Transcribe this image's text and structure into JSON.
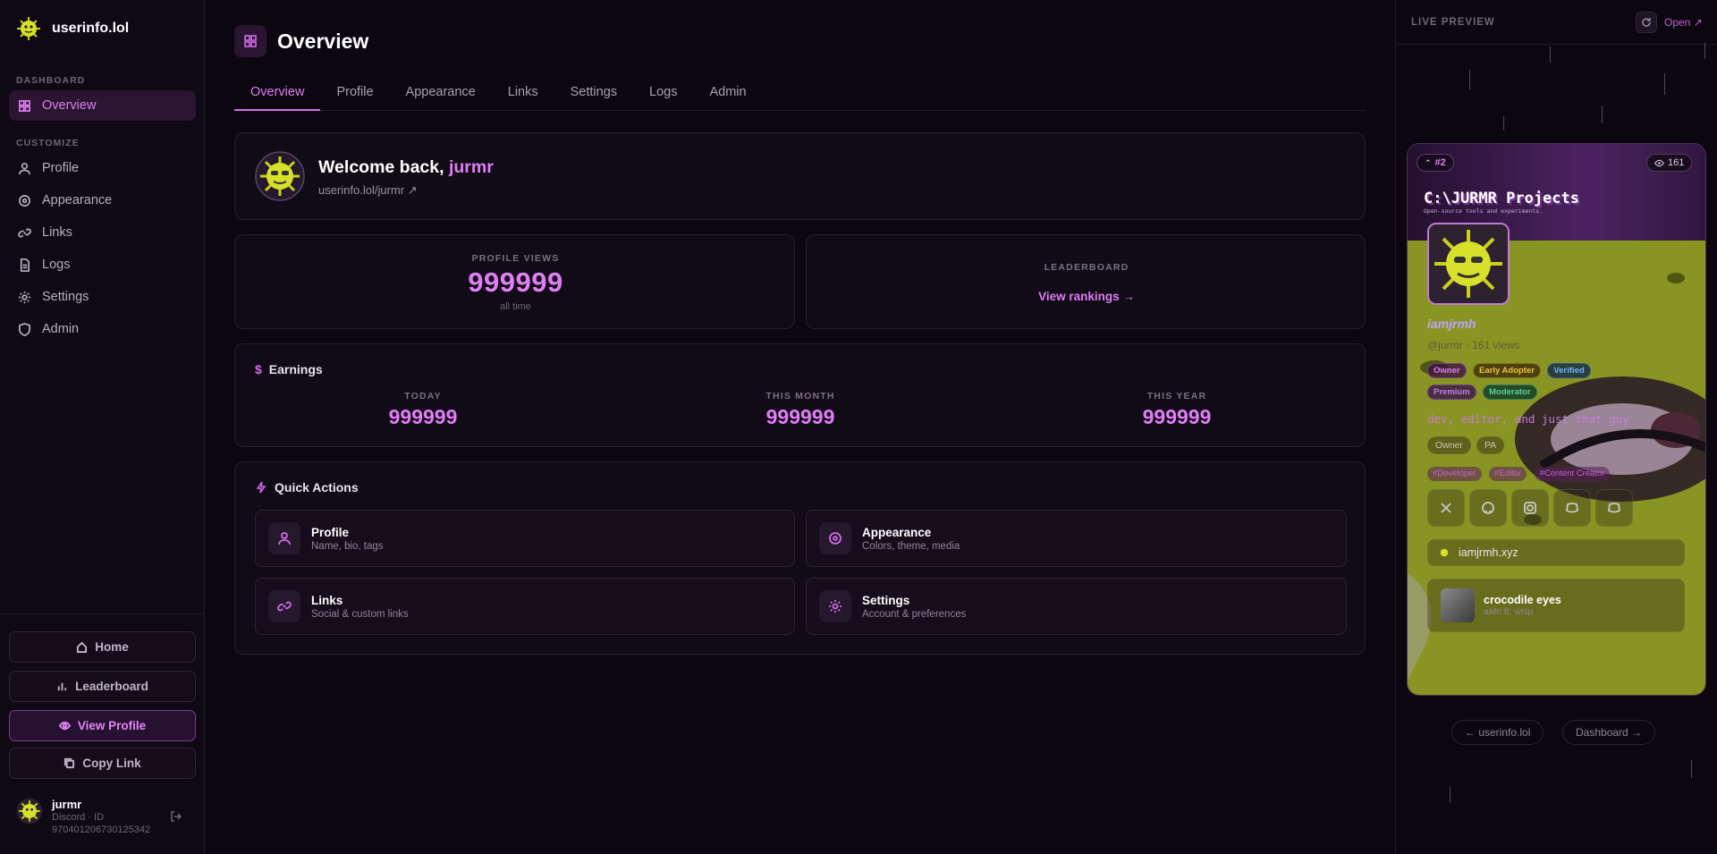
{
  "app": {
    "name": "userinfo.lol"
  },
  "sidebar": {
    "section_dashboard": "DASHBOARD",
    "section_customize": "CUSTOMIZE",
    "items": [
      {
        "label": "Overview",
        "icon": "grid-icon"
      },
      {
        "label": "Profile",
        "icon": "user-icon"
      },
      {
        "label": "Appearance",
        "icon": "palette-icon"
      },
      {
        "label": "Links",
        "icon": "link-icon"
      },
      {
        "label": "Logs",
        "icon": "file-icon"
      },
      {
        "label": "Settings",
        "icon": "gear-icon"
      },
      {
        "label": "Admin",
        "icon": "shield-icon"
      }
    ],
    "buttons": {
      "home": "Home",
      "leaderboard": "Leaderboard",
      "view_profile": "View Profile",
      "copy_link": "Copy Link"
    },
    "user": {
      "name": "jurmr",
      "discord_label": "Discord · ID",
      "discord_id": "970401206730125342"
    }
  },
  "main": {
    "title": "Overview",
    "tabs": [
      "Overview",
      "Profile",
      "Appearance",
      "Links",
      "Settings",
      "Logs",
      "Admin"
    ],
    "welcome": {
      "prefix": "Welcome back,",
      "username": "jurmr",
      "link": "userinfo.lol/jurmr ↗"
    },
    "stats": {
      "views_label": "PROFILE VIEWS",
      "views_value": "999999",
      "views_sub": "all time",
      "leaderboard_label": "LEADERBOARD",
      "leaderboard_link": "View rankings →"
    },
    "earnings": {
      "title": "Earnings",
      "today_label": "TODAY",
      "today": "999999",
      "month_label": "THIS MONTH",
      "month": "999999",
      "year_label": "THIS YEAR",
      "year": "999999"
    },
    "quick": {
      "title": "Quick Actions",
      "actions": [
        {
          "title": "Profile",
          "sub": "Name, bio, tags"
        },
        {
          "title": "Appearance",
          "sub": "Colors, theme, media"
        },
        {
          "title": "Links",
          "sub": "Social & custom links"
        },
        {
          "title": "Settings",
          "sub": "Account & preferences"
        }
      ]
    }
  },
  "preview": {
    "label": "LIVE PREVIEW",
    "open": "Open ↗",
    "rank": "#2",
    "views": "161",
    "banner_title": "C:\\JURMR Projects",
    "banner_sub": "Open-source tools and experiments.",
    "display_name": "iamjrmh",
    "handle": "@jurmr",
    "view_count": "161 views",
    "badges": [
      "Owner",
      "Early Adopter",
      "Verified",
      "Premium",
      "Moderator"
    ],
    "bio": "dev, editor, and just that guy",
    "meta": [
      "Owner",
      "PA"
    ],
    "tags": [
      "#Developer",
      "#Editor",
      "#Content Creator"
    ],
    "socials": [
      "x-icon",
      "github-icon",
      "instagram-icon",
      "discord-icon",
      "discord-icon"
    ],
    "website": "iamjrmh.xyz",
    "track": {
      "title": "crocodile eyes",
      "artist": "aldn ft. wisp"
    },
    "footer": {
      "back": "← userinfo.lol",
      "dashboard": "Dashboard →"
    },
    "colors": {
      "accent": "#e07ef5",
      "card_green": "#a5b526",
      "banner_purple": "#5a2a73"
    }
  }
}
